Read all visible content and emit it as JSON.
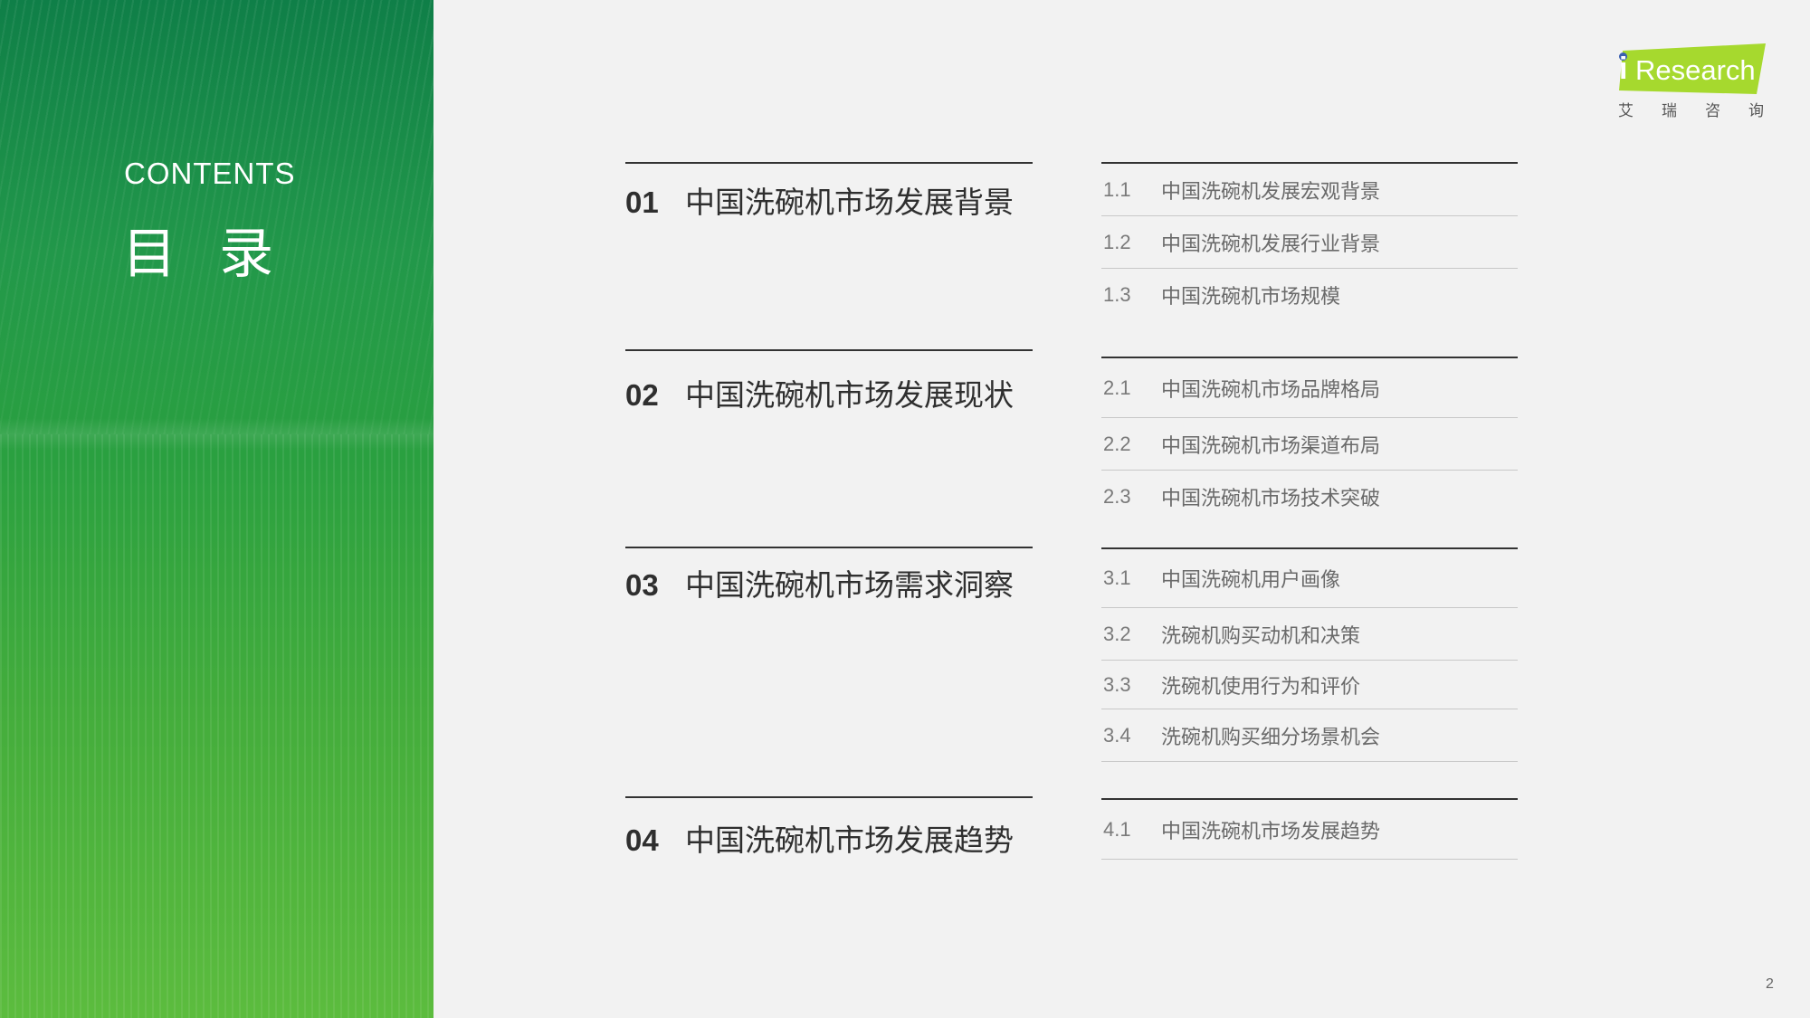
{
  "sidebar": {
    "contents_label": "CONTENTS",
    "title": "目 录"
  },
  "logo": {
    "brand_i": "i",
    "brand_rest": "Research",
    "chinese": "艾瑞咨询",
    "accent_color": "#a6d92e",
    "dot_color": "#3a5fb0"
  },
  "sections": [
    {
      "num": "01",
      "title": "中国洗碗机市场发展背景",
      "items": [
        {
          "num": "1.1",
          "text": "中国洗碗机发展宏观背景"
        },
        {
          "num": "1.2",
          "text": "中国洗碗机发展行业背景"
        },
        {
          "num": "1.3",
          "text": "中国洗碗机市场规模"
        }
      ]
    },
    {
      "num": "02",
      "title": "中国洗碗机市场发展现状",
      "items": [
        {
          "num": "2.1",
          "text": "中国洗碗机市场品牌格局"
        },
        {
          "num": "2.2",
          "text": "中国洗碗机市场渠道布局"
        },
        {
          "num": "2.3",
          "text": "中国洗碗机市场技术突破"
        }
      ]
    },
    {
      "num": "03",
      "title": "中国洗碗机市场需求洞察",
      "items": [
        {
          "num": "3.1",
          "text": "中国洗碗机用户画像"
        },
        {
          "num": "3.2",
          "text": "洗碗机购买动机和决策"
        },
        {
          "num": "3.3",
          "text": "洗碗机使用行为和评价"
        },
        {
          "num": "3.4",
          "text": "洗碗机购买细分场景机会"
        }
      ]
    },
    {
      "num": "04",
      "title": "中国洗碗机市场发展趋势",
      "items": [
        {
          "num": "4.1",
          "text": "中国洗碗机市场发展趋势"
        }
      ]
    }
  ],
  "page_number": "2",
  "colors": {
    "green_dark": "#0f7f48",
    "green_light": "#5cbc3e",
    "background": "#f2f2f2",
    "heading_text": "#2f2f2f",
    "sub_text": "#6a6a6a"
  }
}
